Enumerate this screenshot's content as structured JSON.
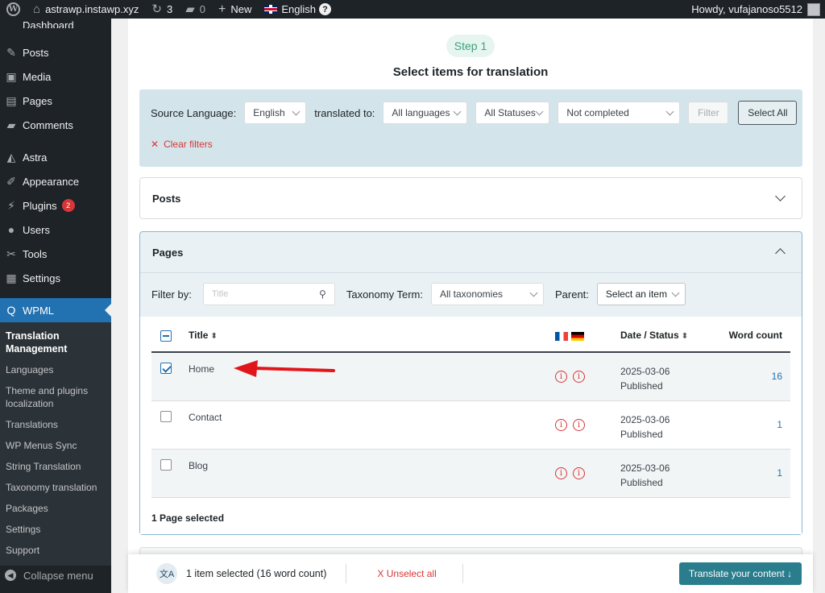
{
  "admin_bar": {
    "site_name": "astrawp.instawp.xyz",
    "updates_count": "3",
    "comments_count": "0",
    "new_label": "New",
    "language_label": "English",
    "help_glyph": "?",
    "greeting": "Howdy, vufajanoso5512"
  },
  "sidebar": {
    "dashboard": "Dashboard",
    "items": [
      {
        "label": "Posts",
        "icon": "pin-icon"
      },
      {
        "label": "Media",
        "icon": "media-icon"
      },
      {
        "label": "Pages",
        "icon": "pages-icon"
      },
      {
        "label": "Comments",
        "icon": "comments-icon"
      },
      {
        "label": "Astra",
        "icon": "astra-icon"
      },
      {
        "label": "Appearance",
        "icon": "appearance-icon"
      },
      {
        "label": "Plugins",
        "icon": "plugins-icon",
        "badge": "2"
      },
      {
        "label": "Users",
        "icon": "users-icon"
      },
      {
        "label": "Tools",
        "icon": "tools-icon"
      },
      {
        "label": "Settings",
        "icon": "settings-icon"
      }
    ],
    "wpml_label": "WPML",
    "submenu": [
      "Translation Management",
      "Languages",
      "Theme and plugins localization",
      "Translations",
      "WP Menus Sync",
      "String Translation",
      "Taxonomy translation",
      "Packages",
      "Settings",
      "Support"
    ],
    "collapse_label": "Collapse menu"
  },
  "main": {
    "step_label": "Step 1",
    "title": "Select items for translation",
    "filters": {
      "source_language_label": "Source Language:",
      "source_language_value": "English",
      "translated_to_label": "translated to:",
      "translated_to_value": "All languages",
      "status_value": "All Statuses",
      "completion_value": "Not completed",
      "filter_button": "Filter",
      "select_all_button": "Select All",
      "clear_filters": "Clear filters"
    },
    "posts_panel": {
      "title": "Posts"
    },
    "pages_panel": {
      "title": "Pages",
      "filter_by_label": "Filter by:",
      "title_placeholder": "Title",
      "taxonomy_label": "Taxonomy Term:",
      "taxonomy_value": "All taxonomies",
      "parent_label": "Parent:",
      "parent_value": "Select an item",
      "columns": {
        "title": "Title",
        "date_status": "Date / Status",
        "word_count": "Word count"
      },
      "rows": [
        {
          "title": "Home",
          "date": "2025-03-06",
          "status": "Published",
          "word_count": "16",
          "checked": true
        },
        {
          "title": "Contact",
          "date": "2025-03-06",
          "status": "Published",
          "word_count": "1",
          "checked": false
        },
        {
          "title": "Blog",
          "date": "2025-03-06",
          "status": "Published",
          "word_count": "1",
          "checked": false
        }
      ],
      "selected_summary": "1 Page selected"
    }
  },
  "bottom_bar": {
    "summary": "1 item selected (16 word count)",
    "unselect": "X Unselect all",
    "translate_button": "Translate your content ↓",
    "translate_icon_glyph": "文A"
  },
  "colors": {
    "accent": "#2271b1",
    "wpml_active": "#2271b1",
    "danger": "#d63638",
    "translate_button": "#2a7d8c",
    "filter_bar_bg": "#d3e5ea"
  }
}
